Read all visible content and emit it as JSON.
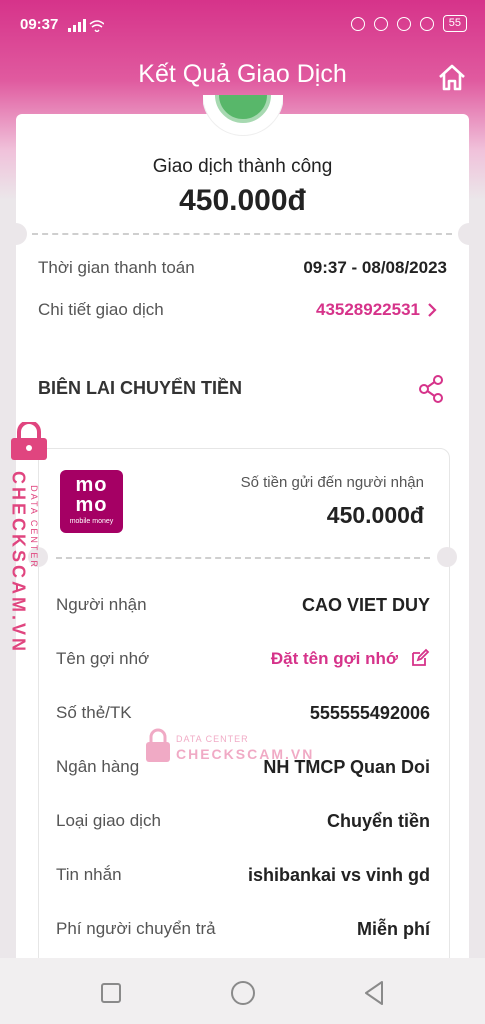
{
  "status_bar": {
    "time": "09:37",
    "battery": "55"
  },
  "header": {
    "title": "Kết Quả Giao Dịch",
    "home_icon": "home-icon"
  },
  "result": {
    "status": "Giao dịch thành công",
    "amount": "450.000đ"
  },
  "details": {
    "time_label": "Thời gian thanh toán",
    "time_value": "09:37 - 08/08/2023",
    "detail_label": "Chi tiết giao dịch",
    "detail_value": "43528922531"
  },
  "receipt": {
    "title": "BIÊN LAI CHUYỂN TIỀN",
    "logo_line1": "mo",
    "logo_line2": "mo",
    "logo_sub": "mobile money",
    "sent_label": "Số tiền gửi đến người nhận",
    "sent_amount": "450.000đ",
    "rows": [
      {
        "label": "Người nhận",
        "value": "CAO VIET DUY"
      },
      {
        "label": "Tên gợi nhớ",
        "value": "Đặt tên gợi nhớ"
      },
      {
        "label": "Số thẻ/TK",
        "value": "555555492006"
      },
      {
        "label": "Ngân hàng",
        "value": "NH TMCP Quan Doi"
      },
      {
        "label": "Loại giao dịch",
        "value": "Chuyển tiền"
      },
      {
        "label": "Tin nhắn",
        "value": "ishibankai vs vinh gd"
      },
      {
        "label": "Phí người chuyển trả",
        "value": "Miễn phí"
      }
    ]
  },
  "watermark": {
    "line1": "DATA CENTER",
    "line2": "CHECKSCAM.VN"
  },
  "colors": {
    "brand_pink": "#d6338a",
    "momo": "#a50064"
  }
}
